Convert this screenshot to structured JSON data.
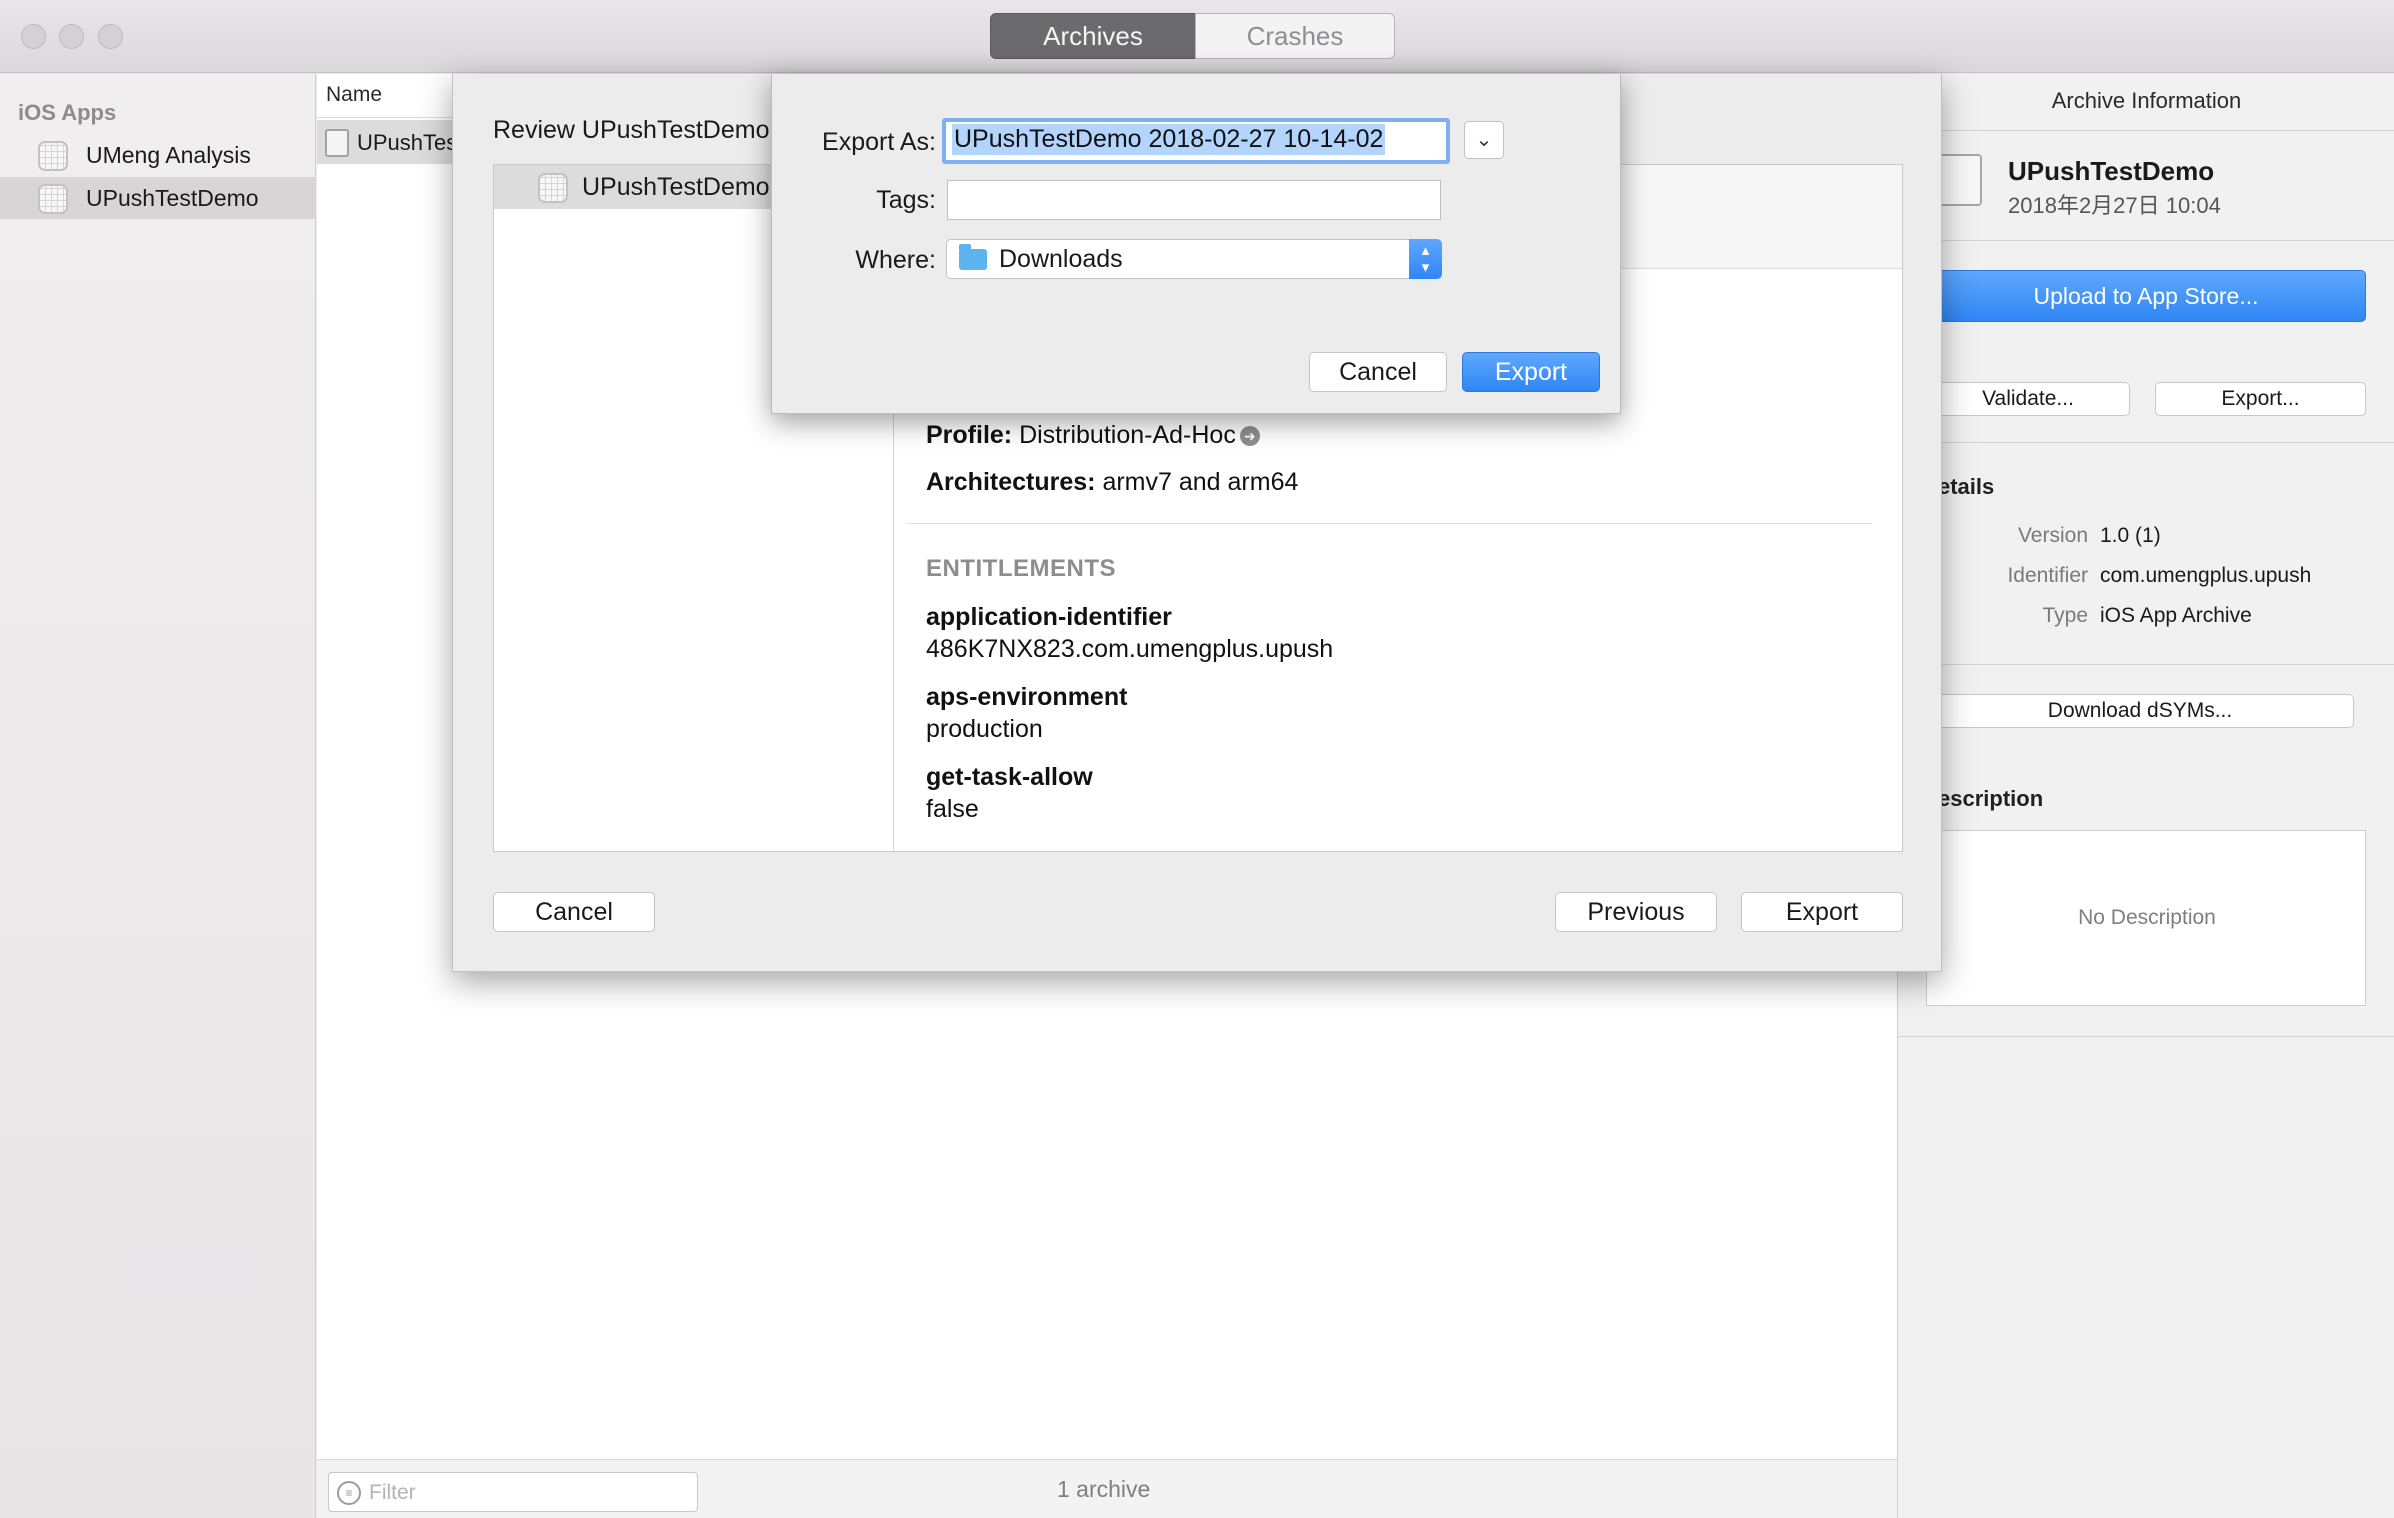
{
  "titlebar": {
    "tabs": [
      {
        "label": "Archives",
        "active": true
      },
      {
        "label": "Crashes",
        "active": false
      }
    ]
  },
  "sidebar": {
    "header": "iOS Apps",
    "items": [
      {
        "label": "UMeng Analysis",
        "selected": false
      },
      {
        "label": "UPushTestDemo",
        "selected": true
      }
    ]
  },
  "list": {
    "column_name": "Name",
    "rows": [
      {
        "name": "UPushTes"
      }
    ],
    "filter_placeholder": "Filter",
    "count_text": "1 archive"
  },
  "inspector": {
    "title": "Archive Information",
    "app_name": "UPushTestDemo",
    "app_date": "2018年2月27日 10:04",
    "upload_label": "Upload to App Store...",
    "validate_label": "Validate...",
    "export_label": "Export...",
    "details_label": "etails",
    "details": {
      "version_key": "Version",
      "version_val": "1.0 (1)",
      "identifier_key": "Identifier",
      "identifier_val": "com.umengplus.upush",
      "type_key": "Type",
      "type_val": "iOS App Archive"
    },
    "download_dsyms_label": "Download dSYMs...",
    "description_label": "escription",
    "description_text": "No Description"
  },
  "review_sheet": {
    "title": "Review UPushTestDemo",
    "left_item": "UPushTestDemo",
    "profile_key": "Profile:",
    "profile_val": "Distribution-Ad-Hoc",
    "arch_key": "Architectures:",
    "arch_val": "armv7 and arm64",
    "entitlements_header": "ENTITLEMENTS",
    "entitlements": [
      {
        "key": "application-identifier",
        "value": "486K7NX823.com.umengplus.upush"
      },
      {
        "key": "aps-environment",
        "value": "production"
      },
      {
        "key": "get-task-allow",
        "value": "false"
      }
    ],
    "cancel_label": "Cancel",
    "previous_label": "Previous",
    "export_label": "Export"
  },
  "export_dialog": {
    "export_as_label": "Export As:",
    "export_as_value": "UPushTestDemo 2018-02-27 10-14-02",
    "tags_label": "Tags:",
    "tags_value": "",
    "where_label": "Where:",
    "where_value": "Downloads",
    "cancel_label": "Cancel",
    "export_label": "Export"
  },
  "colors": {
    "accent_blue": "#2f86f4",
    "selection_highlight": "#b3d4fd",
    "focus_ring": "#7fb0ee"
  },
  "icons": [
    "traffic-light-close",
    "traffic-light-minimize",
    "traffic-light-zoom",
    "app-icon",
    "archive-icon",
    "filter-icon",
    "folder-icon",
    "chevron-down-icon",
    "stepper-icon",
    "arrow-right-circle-icon"
  ]
}
